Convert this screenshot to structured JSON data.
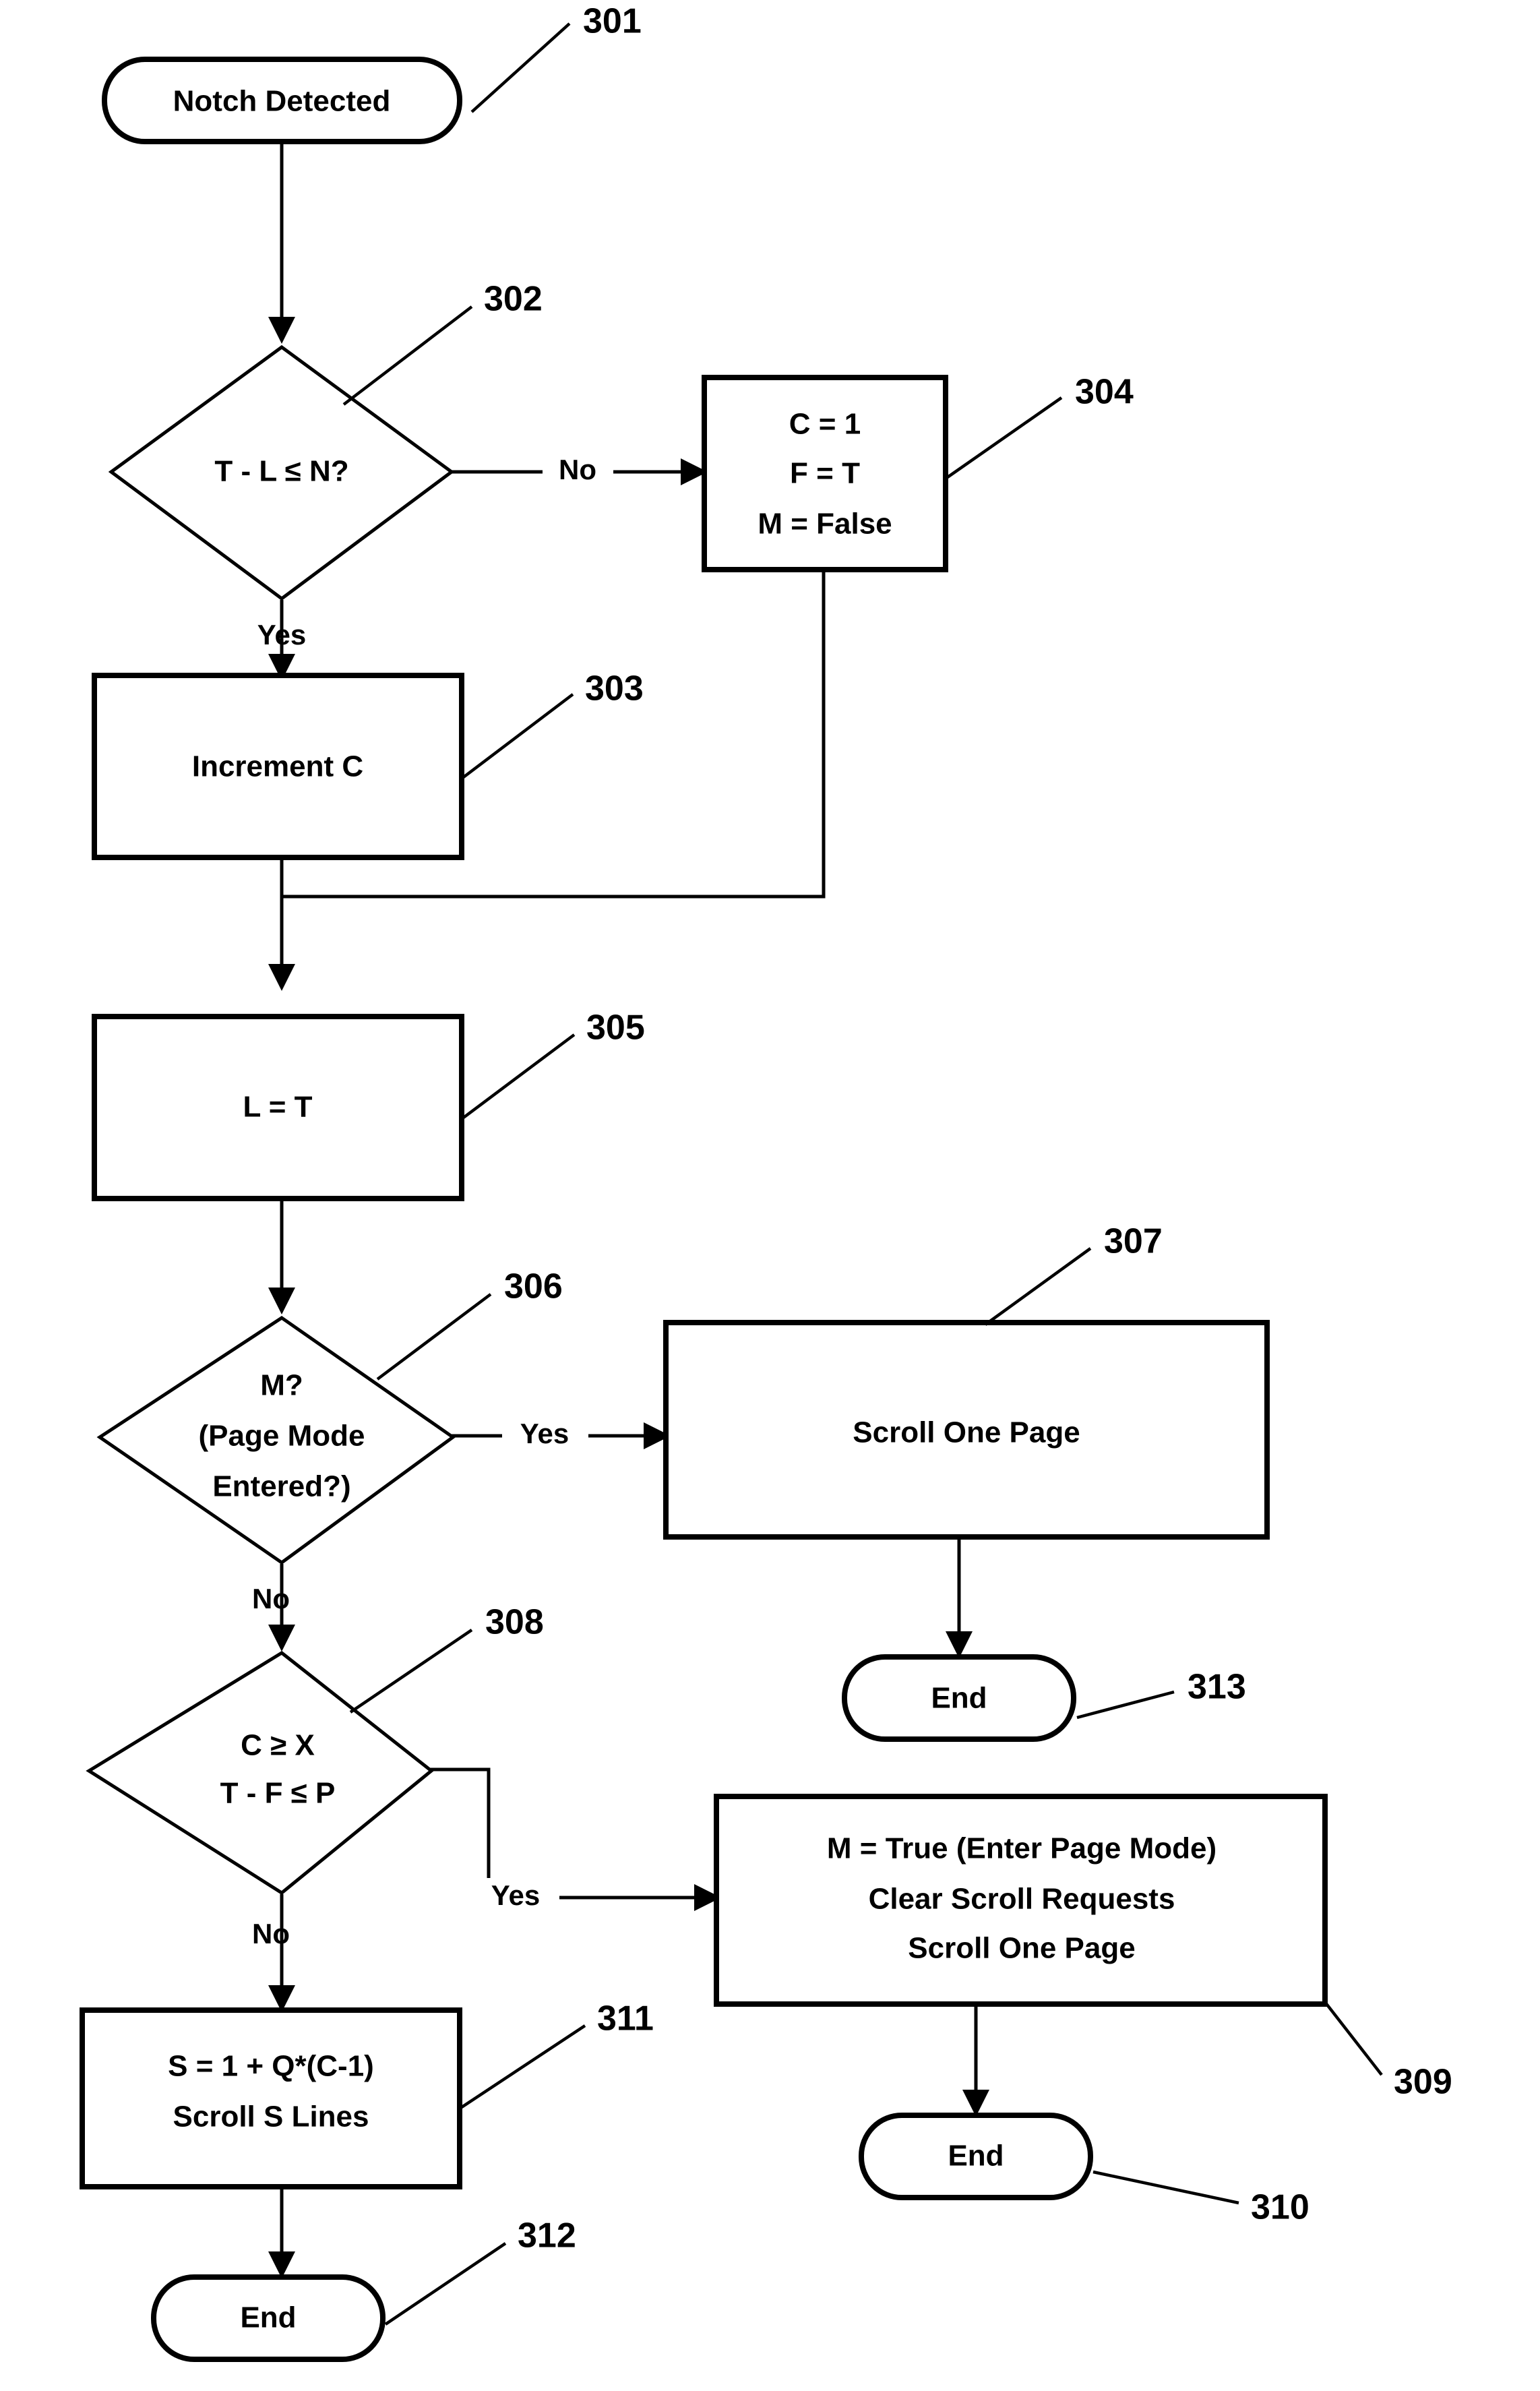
{
  "diagram": {
    "title": "Notch scroll handling flowchart",
    "background_color": "#ffffff",
    "line_color": "#000000"
  },
  "nodes": {
    "start_301": {
      "ref": "301",
      "shape": "terminator",
      "text": "Notch Detected"
    },
    "decision_302": {
      "ref": "302",
      "shape": "decision",
      "text": "T - L  ≤  N?"
    },
    "process_303": {
      "ref": "303",
      "shape": "process",
      "text": "Increment C"
    },
    "process_304": {
      "ref": "304",
      "shape": "process",
      "line1": "C = 1",
      "line2": "F = T",
      "line3": "M = False"
    },
    "process_305": {
      "ref": "305",
      "shape": "process",
      "text": "L = T"
    },
    "decision_306": {
      "ref": "306",
      "shape": "decision",
      "line1": "M?",
      "line2": "(Page Mode",
      "line3": "Entered?)"
    },
    "process_307": {
      "ref": "307",
      "shape": "process",
      "text": "Scroll One Page"
    },
    "decision_308": {
      "ref": "308",
      "shape": "decision",
      "line1": "C ≥  X",
      "line2": "T - F  ≤  P"
    },
    "process_309": {
      "ref": "309",
      "shape": "process",
      "line1": "M = True (Enter Page Mode)",
      "line2": "Clear Scroll Requests",
      "line3": "Scroll One Page"
    },
    "end_310": {
      "ref": "310",
      "shape": "terminator",
      "text": "End"
    },
    "process_311": {
      "ref": "311",
      "shape": "process",
      "line1": "S = 1 + Q*(C-1)",
      "line2": "Scroll S Lines"
    },
    "end_312": {
      "ref": "312",
      "shape": "terminator",
      "text": "End"
    },
    "end_313": {
      "ref": "313",
      "shape": "terminator",
      "text": "End"
    }
  },
  "edge_labels": {
    "e302_no": "No",
    "e302_yes": "Yes",
    "e306_yes": "Yes",
    "e306_no": "No",
    "e308_yes": "Yes",
    "e308_no": "No"
  },
  "reference_numerals": {
    "r301": "301",
    "r302": "302",
    "r303": "303",
    "r304": "304",
    "r305": "305",
    "r306": "306",
    "r307": "307",
    "r308": "308",
    "r309": "309",
    "r310": "310",
    "r311": "311",
    "r312": "312",
    "r313": "313"
  }
}
